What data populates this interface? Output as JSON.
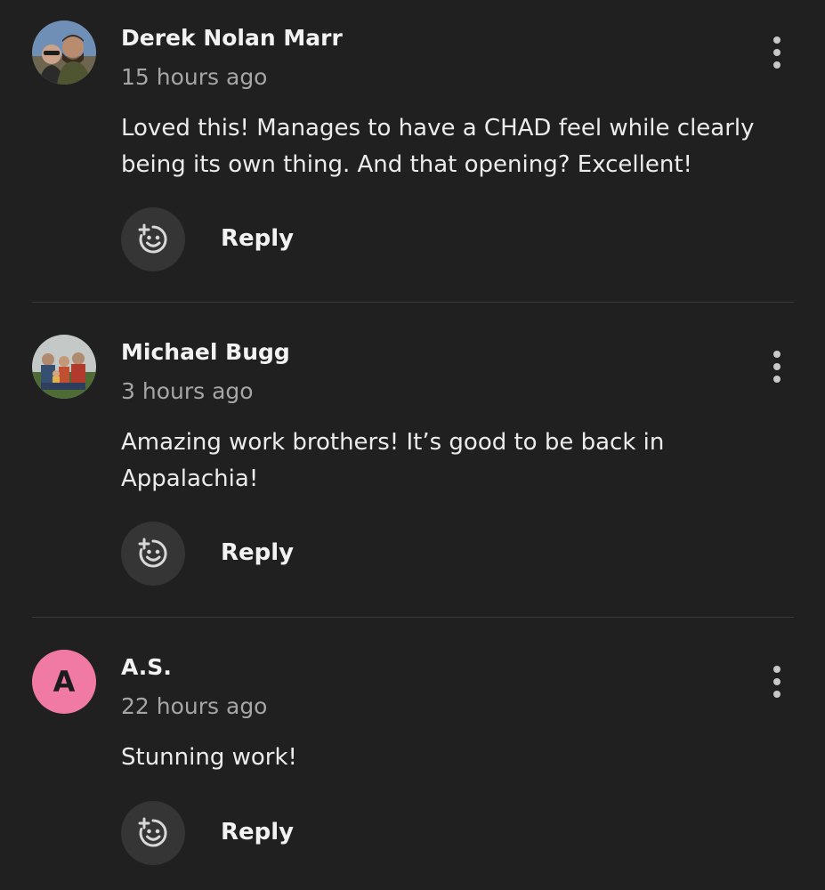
{
  "comments": [
    {
      "author": "Derek Nolan Marr",
      "time": "15 hours ago",
      "text": "Loved this! Manages to have a CHAD feel while clearly being its own thing.  And that opening? Excellent!",
      "reply_label": "Reply",
      "avatar_icon": "user-photo-avatar",
      "react_icon": "add-reaction-icon",
      "more_icon": "more-vertical-icon"
    },
    {
      "author": "Michael Bugg",
      "time": "3 hours ago",
      "text": "Amazing work brothers! It’s good to be back in Appalachia!",
      "reply_label": "Reply",
      "avatar_icon": "user-photo-avatar",
      "react_icon": "add-reaction-icon",
      "more_icon": "more-vertical-icon"
    },
    {
      "author": "A.S.",
      "avatar_letter": "A",
      "time": "22 hours ago",
      "text": "Stunning work!",
      "reply_label": "Reply",
      "avatar_color": "#f07aa3",
      "react_icon": "add-reaction-icon",
      "more_icon": "more-vertical-icon"
    }
  ],
  "colors": {
    "background": "#202020",
    "text": "#ececec",
    "muted": "#a6a6a6",
    "button_bg": "#353535",
    "divider": "#3a3a3a"
  }
}
